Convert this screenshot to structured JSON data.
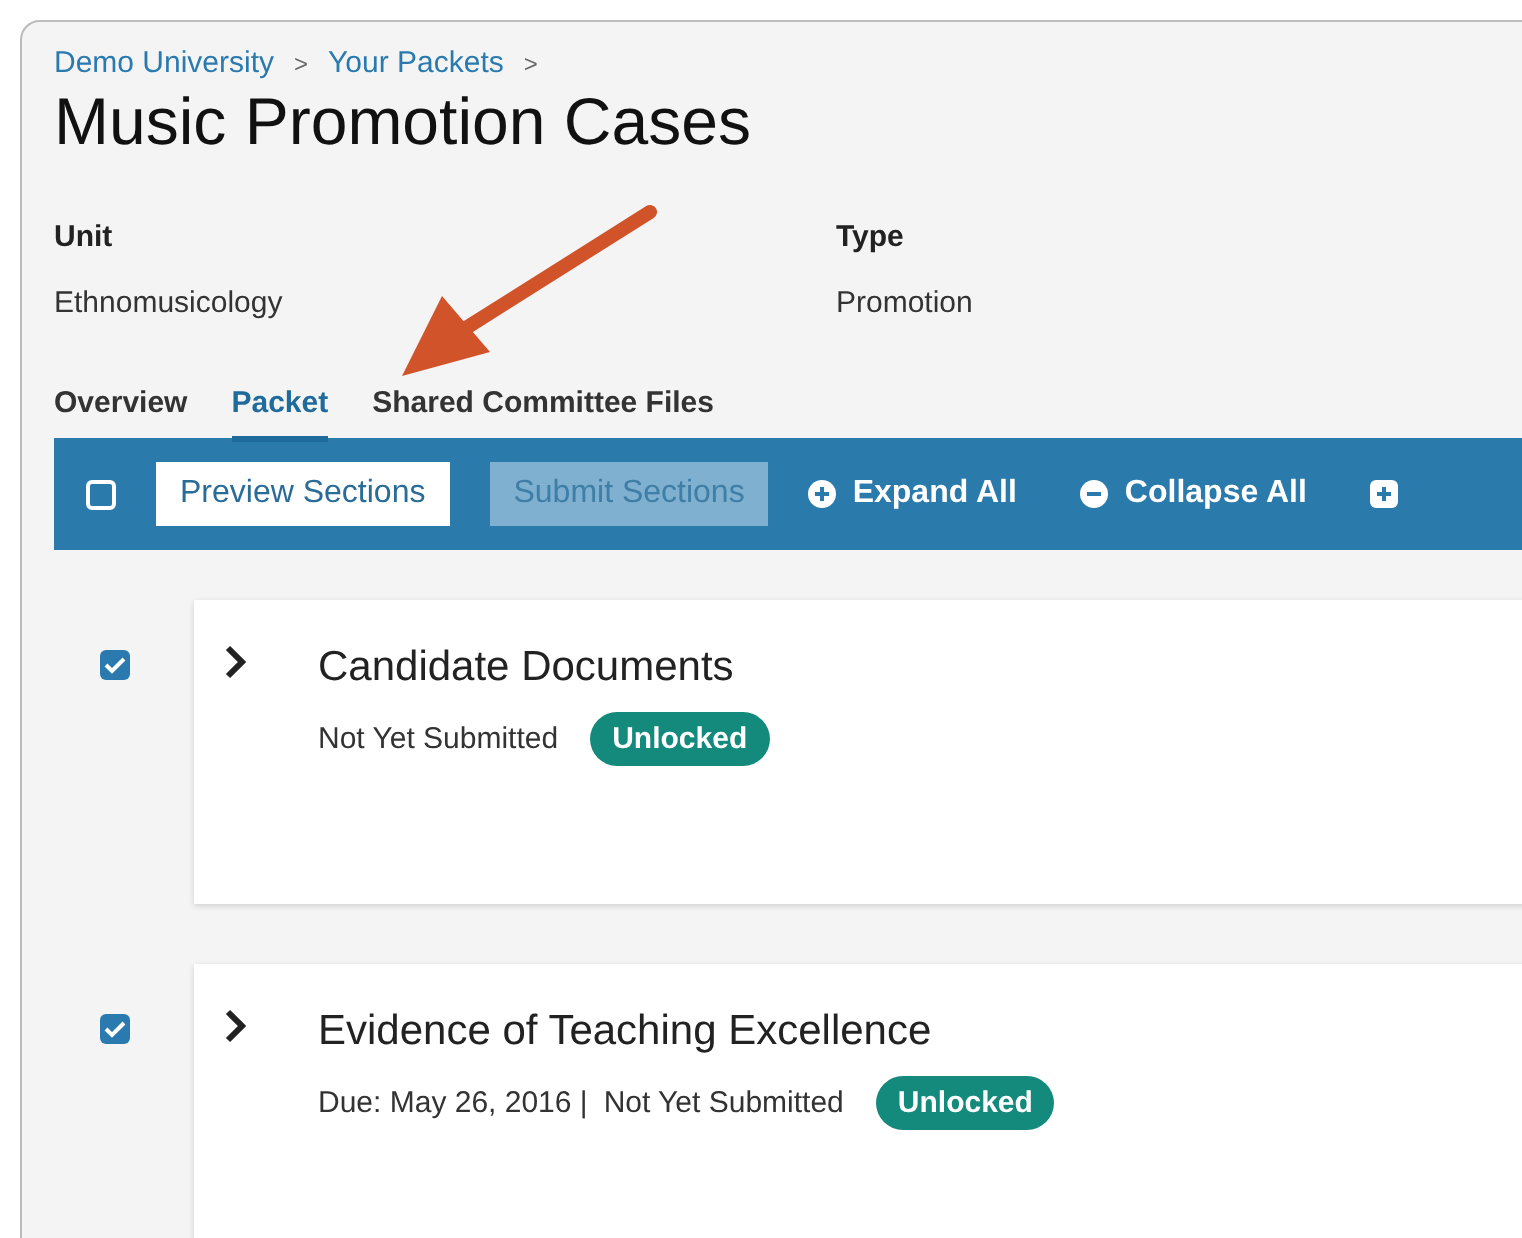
{
  "breadcrumb": {
    "separator": ">",
    "items": [
      "Demo University",
      "Your Packets"
    ]
  },
  "title": "Music Promotion Cases",
  "fields": [
    {
      "label": "Unit",
      "value": "Ethnomusicology"
    },
    {
      "label": "Type",
      "value": "Promotion"
    }
  ],
  "tabs": [
    {
      "label": "Overview",
      "selected": false
    },
    {
      "label": "Packet",
      "selected": true
    },
    {
      "label": "Shared Committee Files",
      "selected": false
    }
  ],
  "toolbar": {
    "checked": false,
    "items": [
      {
        "kind": "button",
        "label": "Preview Sections",
        "disabled": false
      },
      {
        "kind": "button",
        "label": "Submit Sections",
        "disabled": true
      },
      {
        "kind": "plus",
        "label": "Expand All"
      },
      {
        "kind": "minus",
        "label": "Collapse All"
      },
      {
        "kind": "cut"
      }
    ]
  },
  "sections": [
    {
      "title": "Candidate Documents",
      "checked": true,
      "expanded": false,
      "meta": [
        "Not Yet Submitted"
      ],
      "badge": "Unlocked"
    },
    {
      "title": "Evidence of Teaching Excellence",
      "checked": true,
      "expanded": false,
      "meta": [
        "Due: May 26, 2016 |",
        "Not Yet Submitted"
      ],
      "badge": "Unlocked"
    }
  ]
}
